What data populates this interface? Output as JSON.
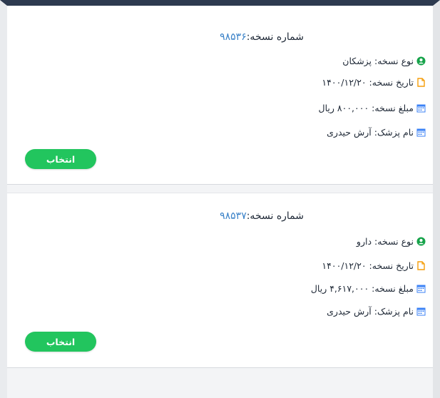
{
  "cards": [
    {
      "title_label": "شماره نسخه:",
      "title_number": "۹۸۵۳۶",
      "type_text": "نوع نسخه: پزشکان",
      "date_text": "تاریخ نسخه: ۱۴۰۰/۱۲/۲۰",
      "amount_text": "مبلغ نسخه: ۸۰۰,۰۰۰ ریال",
      "doctor_text": "نام پزشک: آرش حیدری",
      "select_label": "انتخاب"
    },
    {
      "title_label": "شماره نسخه:",
      "title_number": "۹۸۵۳۷",
      "type_text": "نوع نسخه: دارو",
      "date_text": "تاریخ نسخه: ۱۴۰۰/۱۲/۲۰",
      "amount_text": "مبلغ نسخه: ۴,۶۱۷,۰۰۰ ریال",
      "doctor_text": "نام پزشک: آرش حیدری",
      "select_label": "انتخاب"
    }
  ],
  "icons": {
    "type": "user-circle-icon",
    "date": "document-icon",
    "amount": "calendar-icon",
    "doctor": "calendar-icon"
  },
  "colors": {
    "accent_green": "#22c55e",
    "number_blue": "#3b82c8",
    "user_icon_green": "#16a34a",
    "document_icon_orange": "#f59e0b",
    "calendar_icon_blue": "#3b82f6"
  }
}
